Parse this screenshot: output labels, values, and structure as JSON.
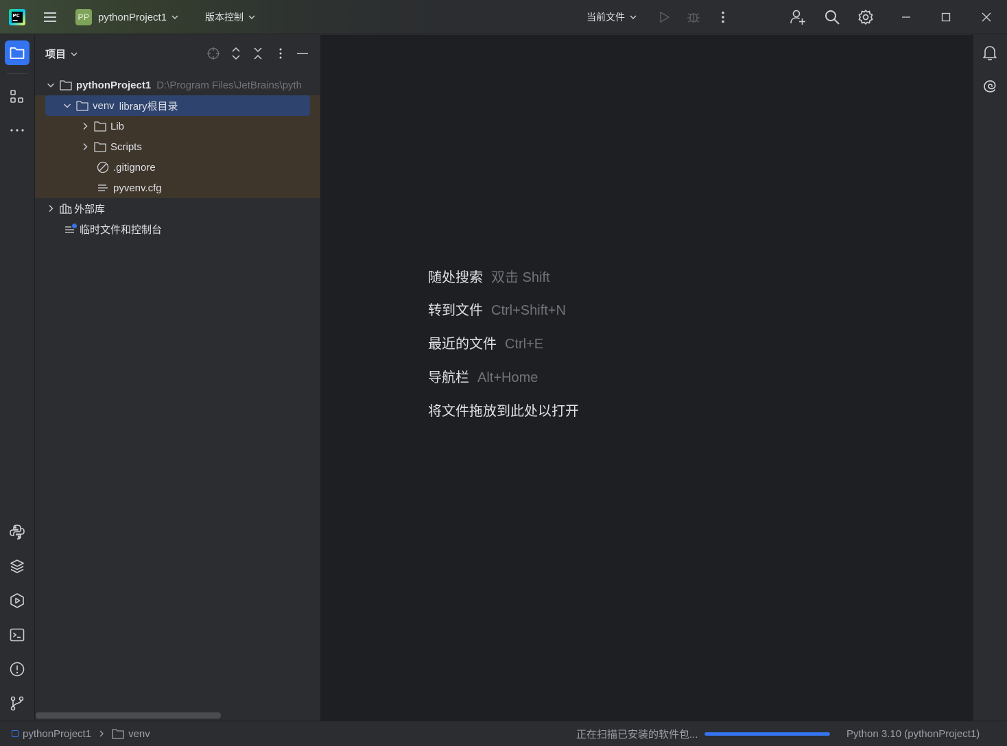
{
  "titlebar": {
    "project_badge": "PP",
    "project_name": "pythonProject1",
    "vcs_label": "版本控制",
    "run_config": "当前文件"
  },
  "project_panel": {
    "title": "项目",
    "tree": {
      "root_name": "pythonProject1",
      "root_path": "D:\\Program Files\\JetBrains\\pyth",
      "venv_name": "venv",
      "venv_tag": "library根目录",
      "lib": "Lib",
      "scripts": "Scripts",
      "gitignore": ".gitignore",
      "pyvenv": "pyvenv.cfg",
      "external_libs": "外部库",
      "scratches": "临时文件和控制台"
    }
  },
  "editor": {
    "hints": [
      {
        "label": "随处搜索",
        "key": "双击 Shift"
      },
      {
        "label": "转到文件",
        "key": "Ctrl+Shift+N"
      },
      {
        "label": "最近的文件",
        "key": "Ctrl+E"
      },
      {
        "label": "导航栏",
        "key": "Alt+Home"
      },
      {
        "label": "将文件拖放到此处以打开",
        "key": ""
      }
    ]
  },
  "statusbar": {
    "breadcrumb_project": "pythonProject1",
    "breadcrumb_folder": "venv",
    "task_text": "正在扫描已安装的软件包...",
    "task_progress": 1.0,
    "interpreter": "Python 3.10 (pythonProject1)"
  },
  "colors": {
    "accent": "#3574f0",
    "selection": "#2e436e",
    "excluded_bg": "#3e352b",
    "badge": "#7ea35a"
  }
}
